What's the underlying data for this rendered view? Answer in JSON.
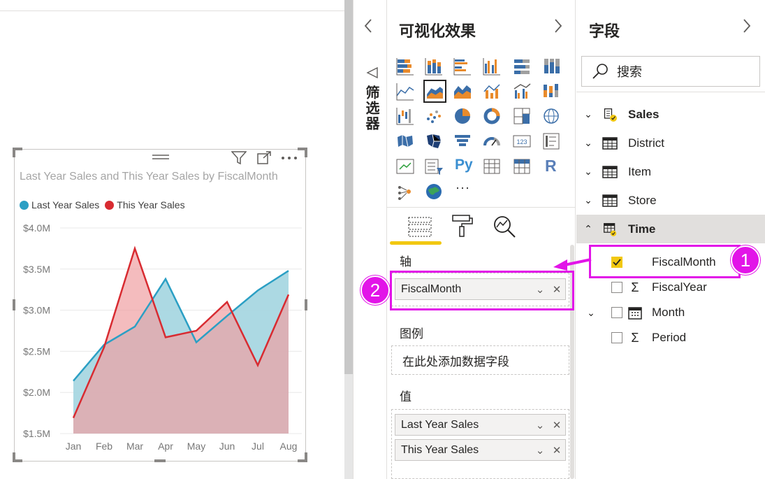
{
  "visual": {
    "title": "Last Year Sales and This Year Sales by FiscalMonth",
    "legend": [
      {
        "label": "Last Year Sales",
        "color": "#2b9fc4"
      },
      {
        "label": "This Year Sales",
        "color": "#d82b31"
      }
    ],
    "header_icons": [
      "filter-icon",
      "focus-mode-icon",
      "more-options-icon"
    ]
  },
  "chart_data": {
    "type": "area",
    "title": "Last Year Sales and This Year Sales by FiscalMonth",
    "categories": [
      "Jan",
      "Feb",
      "Mar",
      "Apr",
      "May",
      "Jun",
      "Jul",
      "Aug"
    ],
    "y_tick_labels": [
      "$4.0M",
      "$3.5M",
      "$3.0M",
      "$2.5M",
      "$2.0M",
      "$1.5M"
    ],
    "y_ticks": [
      4.0,
      3.5,
      3.0,
      2.5,
      2.0,
      1.5
    ],
    "ylim": [
      1.5,
      4.0
    ],
    "grid": true,
    "legend_position": "top-left",
    "series": [
      {
        "name": "Last Year Sales",
        "color": "#2b9fc4",
        "fill": "#a8d7e2",
        "values": [
          2.14,
          2.58,
          2.8,
          3.38,
          2.61,
          2.93,
          3.24,
          3.48
        ]
      },
      {
        "name": "This Year Sales",
        "color": "#d82b31",
        "fill": "#f0a0a3",
        "values": [
          1.69,
          2.55,
          3.75,
          2.67,
          2.75,
          3.1,
          2.33,
          3.19
        ]
      }
    ]
  },
  "filters_pane": {
    "label": "筛选器",
    "collapse_icon": "chevron-left-icon"
  },
  "viz_pane": {
    "title": "可视化效果",
    "expand_icon": "chevron-right-icon",
    "tabs": [
      "fields-tab-icon",
      "format-paint-roller-icon",
      "analytics-magnifier-icon"
    ],
    "wells": {
      "axis": {
        "label": "轴",
        "pill": "FiscalMonth"
      },
      "legend": {
        "label": "图例",
        "placeholder": "在此处添加数据字段"
      },
      "values": {
        "label": "值",
        "pills": [
          "Last Year Sales",
          "This Year Sales"
        ]
      }
    },
    "more_label": "···",
    "py_label": "Py",
    "r_label": "R",
    "card_label": "123"
  },
  "fields_pane": {
    "title": "字段",
    "expand_icon": "chevron-right-icon",
    "search_placeholder": "搜索",
    "tables": [
      {
        "name": "Sales",
        "expanded": false,
        "bold": true
      },
      {
        "name": "District",
        "expanded": false,
        "bold": false
      },
      {
        "name": "Item",
        "expanded": false,
        "bold": false
      },
      {
        "name": "Store",
        "expanded": false,
        "bold": false
      },
      {
        "name": "Time",
        "expanded": true,
        "bold": true
      }
    ],
    "time_fields": [
      {
        "name": "FiscalMonth",
        "checked": true,
        "type": "text"
      },
      {
        "name": "FiscalYear",
        "checked": false,
        "type": "sigma"
      },
      {
        "name": "Month",
        "checked": false,
        "type": "calendar"
      },
      {
        "name": "Period",
        "checked": false,
        "type": "sigma"
      }
    ]
  },
  "annotations": {
    "badge_1": "1",
    "badge_2": "2",
    "accent": "#e214e8",
    "highlight_yellow": "#f2c811"
  }
}
